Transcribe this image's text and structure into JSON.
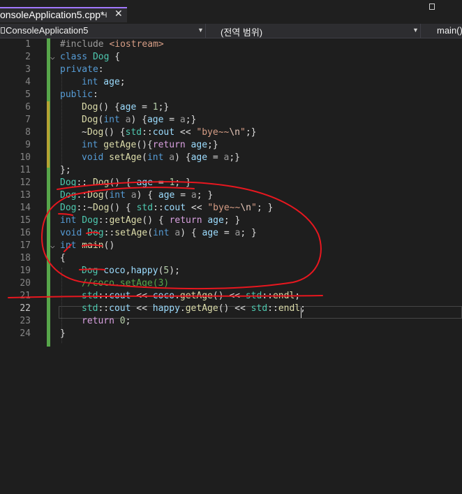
{
  "tab": {
    "title": "onsoleApplication5.cpp*",
    "pin_glyph": "⊣",
    "close_glyph": "✕"
  },
  "navbar": {
    "project": "ConsoleApplication5",
    "scope": "(전역 범위)",
    "member": "main()"
  },
  "code_lines": [
    {
      "n": "1"
    },
    {
      "n": "2"
    },
    {
      "n": "3"
    },
    {
      "n": "4"
    },
    {
      "n": "5"
    },
    {
      "n": "6"
    },
    {
      "n": "7"
    },
    {
      "n": "8"
    },
    {
      "n": "9"
    },
    {
      "n": "10"
    },
    {
      "n": "11"
    },
    {
      "n": "12"
    },
    {
      "n": "13"
    },
    {
      "n": "14"
    },
    {
      "n": "15"
    },
    {
      "n": "16"
    },
    {
      "n": "17"
    },
    {
      "n": "18"
    },
    {
      "n": "19"
    },
    {
      "n": "20"
    },
    {
      "n": "21"
    },
    {
      "n": "22"
    },
    {
      "n": "23"
    },
    {
      "n": "24"
    }
  ],
  "code": {
    "l1_pp": "#include",
    "l1_inc": " <iostream>",
    "l2_kw": "class",
    "l2_ty": " Dog",
    "l2_rest": " {",
    "l3_kw": "private",
    "l3_rest": ":",
    "l4_kw": "int",
    "l4_var": " age",
    "l4_rest": ";",
    "l5_kw": "public",
    "l5_rest": ":",
    "l6_fn": "Dog",
    "l6_a": "() {",
    "l6_var": "age",
    "l6_b": " = ",
    "l6_num": "1",
    "l6_c": ";}",
    "l7_fn": "Dog",
    "l7_a": "(",
    "l7_kw": "int",
    "l7_pr": " a",
    "l7_b": ") {",
    "l7_var": "age",
    "l7_c": " = ",
    "l7_pr2": "a",
    "l7_d": ";}",
    "l8_a": "~",
    "l8_fn": "Dog",
    "l8_b": "() {",
    "l8_ty": "std",
    "l8_c": "::",
    "l8_var": "cout",
    "l8_d": " << ",
    "l8_str": "\"bye~~",
    "l8_esc": "\\n",
    "l8_str2": "\"",
    "l8_e": ";}",
    "l9_kw": "int",
    "l9_fn": " getAge",
    "l9_a": "(){",
    "l9_ctl": "return",
    "l9_var": " age",
    "l9_b": ";}",
    "l10_kw": "void",
    "l10_fn": " setAge",
    "l10_a": "(",
    "l10_kw2": "int",
    "l10_pr": " a",
    "l10_b": ") {",
    "l10_var": "age",
    "l10_c": " = ",
    "l10_pr2": "a",
    "l10_d": ";}",
    "l11": "};",
    "l12_ty": "Dog",
    "l12_a": ":: ",
    "l12_fn": "Dog",
    "l12_b": "() { ",
    "l12_var": "age",
    "l12_c": " = ",
    "l12_num": "1",
    "l12_d": "; }",
    "l13_ty": "Dog",
    "l13_a": "::",
    "l13_fn": "Dog",
    "l13_b": "(",
    "l13_kw": "int",
    "l13_pr": " a",
    "l13_c": ") { ",
    "l13_var": "age",
    "l13_d": " = ",
    "l13_pr2": "a",
    "l13_e": "; }",
    "l14_ty": "Dog",
    "l14_a": "::~",
    "l14_fn": "Dog",
    "l14_b": "() { ",
    "l14_ty2": "std",
    "l14_c": "::",
    "l14_var": "cout",
    "l14_d": " << ",
    "l14_str": "\"bye~~",
    "l14_esc": "\\n",
    "l14_str2": "\"",
    "l14_e": "; }",
    "l15_kw": "int",
    "l15_ty": " Dog",
    "l15_a": "::",
    "l15_fn": "getAge",
    "l15_b": "() { ",
    "l15_ctl": "return",
    "l15_var": " age",
    "l15_c": "; }",
    "l16_kw": "void",
    "l16_ty": " Dog",
    "l16_a": "::",
    "l16_fn": "setAge",
    "l16_b": "(",
    "l16_kw2": "int",
    "l16_pr": " a",
    "l16_c": ") { ",
    "l16_var": "age",
    "l16_d": " = ",
    "l16_pr2": "a",
    "l16_e": "; }",
    "l17_kw": "int",
    "l17_fn": " main",
    "l17_a": "()",
    "l18": "{",
    "l19_ty": "Dog",
    "l19_var": " coco",
    "l19_a": ",",
    "l19_var2": "happy",
    "l19_b": "(",
    "l19_num": "5",
    "l19_c": ");",
    "l20_cm": "//coco.setAge(3)",
    "l21_ty": "std",
    "l21_a": "::",
    "l21_var": "cout",
    "l21_b": " << ",
    "l21_var2": "coco",
    "l21_c": ".",
    "l21_fn": "getAge",
    "l21_d": "() << ",
    "l21_ty2": "std",
    "l21_e": "::",
    "l21_fn2": "endl",
    "l21_f": ";",
    "l22_ty": "std",
    "l22_a": "::",
    "l22_var": "cout",
    "l22_b": " << ",
    "l22_var2": "happy",
    "l22_c": ".",
    "l22_fn": "getAge",
    "l22_d": "() << ",
    "l22_ty2": "std",
    "l22_e": "::",
    "l22_fn2": "endl",
    "l22_f": ";",
    "l23_ctl": "return",
    "l23_num": " 0",
    "l23_a": ";",
    "l24": "}"
  },
  "colors": {
    "background": "#1e1e1e",
    "keyword": "#569cd6",
    "type": "#4ec9b0",
    "function": "#dcdcaa",
    "variable": "#9cdcfe",
    "number": "#b5cea8",
    "string": "#d69d85",
    "comment": "#57a64a",
    "annotation": "#e8171f",
    "change_bar": "#57a64a"
  }
}
